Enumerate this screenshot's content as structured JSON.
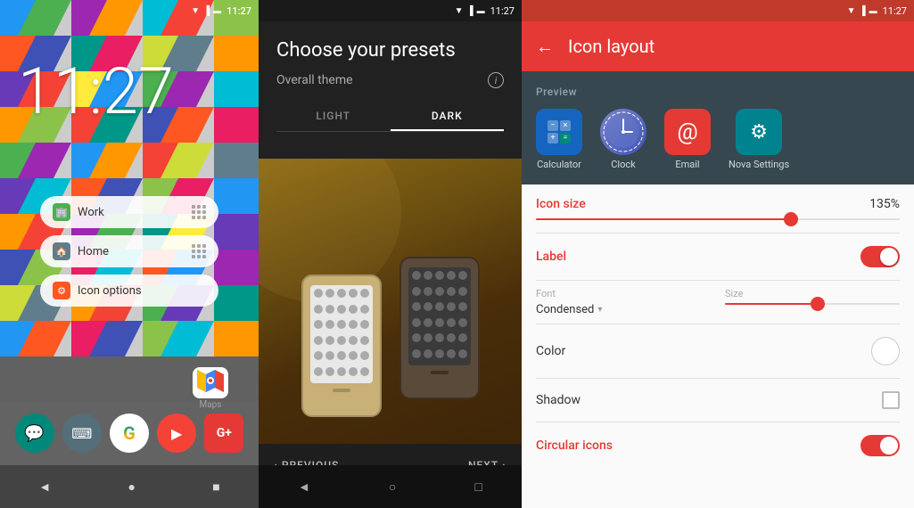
{
  "home": {
    "status_time": "11:27",
    "clock": "11:27",
    "folders": [
      {
        "label": "Work",
        "icon_type": "work"
      },
      {
        "label": "Home",
        "icon_type": "home-i"
      },
      {
        "label": "Icon options",
        "icon_type": "options"
      }
    ],
    "maps_label": "Maps",
    "dock_icons": [
      "💬",
      "⌨",
      "G",
      "▶",
      "G+"
    ],
    "nav_back": "◄",
    "nav_home": "●",
    "nav_recent": "■"
  },
  "presets": {
    "status_time": "11:27",
    "title": "Choose your presets",
    "overall_theme_label": "Overall theme",
    "tabs": [
      {
        "label": "LIGHT",
        "active": false
      },
      {
        "label": "DARK",
        "active": true
      }
    ],
    "nav_previous": "PREVIOUS",
    "nav_next": "NEXT",
    "nav_back": "◄",
    "nav_home": "○",
    "nav_recent": "□"
  },
  "iconlayout": {
    "status_time": "11:27",
    "title": "Icon layout",
    "preview_label": "Preview",
    "icons": [
      {
        "label": "Calculator",
        "type": "calc"
      },
      {
        "label": "Clock",
        "type": "clock"
      },
      {
        "label": "Email",
        "type": "email"
      },
      {
        "label": "Nova Settings",
        "type": "nova"
      }
    ],
    "icon_size_label": "Icon size",
    "icon_size_value": "135%",
    "label_label": "Label",
    "font_label": "Font",
    "size_label": "Size",
    "condensed_label": "Condensed",
    "color_label": "Color",
    "shadow_label": "Shadow",
    "circular_label": "Circular icons",
    "back_arrow": "←"
  }
}
